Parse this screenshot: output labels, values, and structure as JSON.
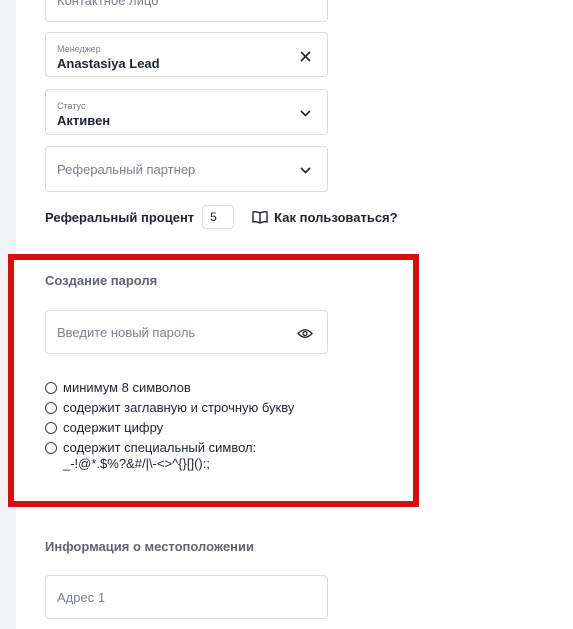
{
  "form": {
    "contact_person_placeholder": "Контактное лицо",
    "manager_label": "Менеджер",
    "manager_value": "Anastasiya Lead",
    "status_label": "Статус",
    "status_value": "Активен",
    "referral_partner_placeholder": "Реферальный партнер",
    "referral_percent_label": "Реферальный процент",
    "referral_percent_value": "5",
    "how_to_use_label": "Как пользоваться?"
  },
  "password": {
    "section_title": "Создание пароля",
    "input_placeholder": "Введите новый пароль",
    "rules": [
      {
        "text": "минимум 8 символов"
      },
      {
        "text": "содержит заглавную и строчную букву"
      },
      {
        "text": "содержит цифру"
      },
      {
        "text": "содержит специальный символ: _-!@*.$%?&#/|\\-<>^{}[]():;"
      }
    ]
  },
  "location": {
    "section_title": "Информация о местоположении",
    "address1_placeholder": "Адрес 1"
  },
  "colors": {
    "highlight": "#d40f0f",
    "border": "#d9dce3",
    "muted_text": "#7c8190"
  }
}
